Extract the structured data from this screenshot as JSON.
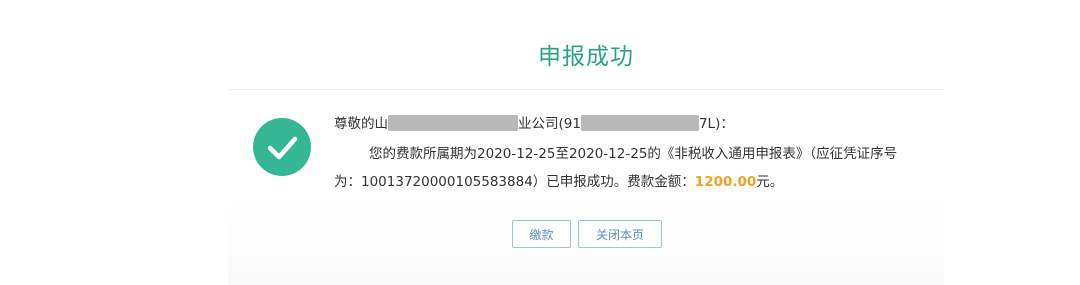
{
  "page": {
    "title": "申报成功"
  },
  "message": {
    "line1_prefix": "尊敬的山",
    "line1_company_suffix": "业公司(91",
    "line1_code_suffix": "7L)：",
    "line2": "您的费款所属期为2020-12-25至2020-12-25的《非税收入通用申报表》（应征凭证序号",
    "line3_prefix": "为：10013720000105583884）已申报成功。费款金额：",
    "amount": "1200.00",
    "line3_suffix": "元。"
  },
  "buttons": {
    "pay_label": "缴款",
    "close_label": "关闭本页"
  },
  "colors": {
    "title": "#27a388",
    "success_badge": "#35b796",
    "amount": "#f2a122",
    "button_border": "#9cc2e0",
    "button_text": "#5d8fbf"
  },
  "icons": {
    "success": "checkmark-circle-icon"
  }
}
